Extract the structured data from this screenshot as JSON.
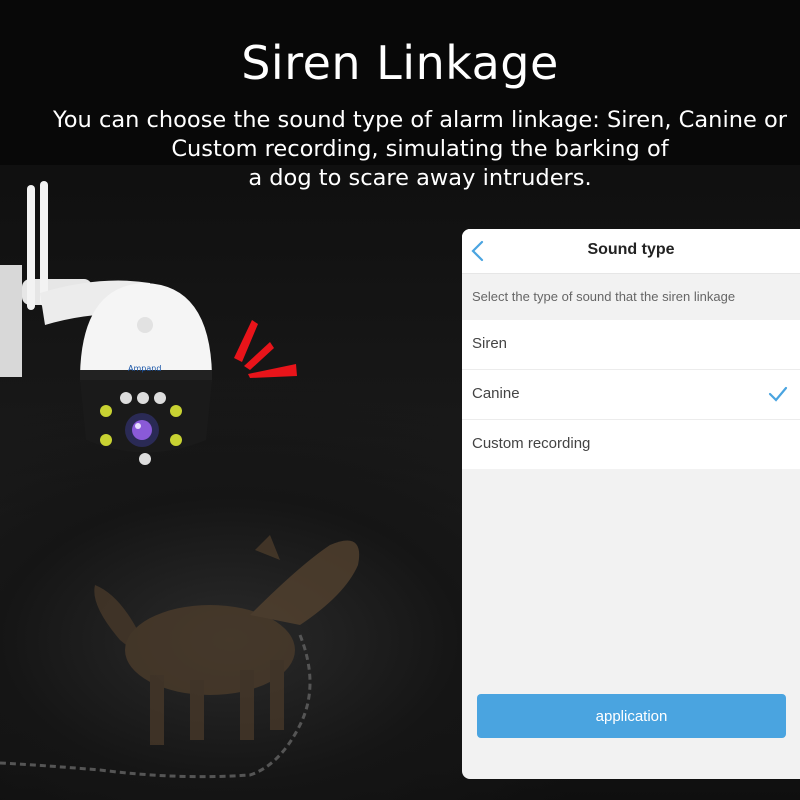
{
  "banner": {
    "title": "Siren Linkage",
    "description": "You can choose the sound type of alarm linkage: Siren, Canine or\nCustom recording, simulating the barking of\na dog to scare away intruders."
  },
  "camera": {
    "brand_logo": "Ampand"
  },
  "phone": {
    "title": "Sound type",
    "hint": "Select the type of sound that the siren linkage",
    "options": [
      {
        "label": "Siren",
        "selected": false
      },
      {
        "label": "Canine",
        "selected": true
      },
      {
        "label": "Custom recording",
        "selected": false
      }
    ],
    "apply_label": "application",
    "colors": {
      "accent": "#4aa4e0",
      "alarm": "#e8141a"
    }
  }
}
